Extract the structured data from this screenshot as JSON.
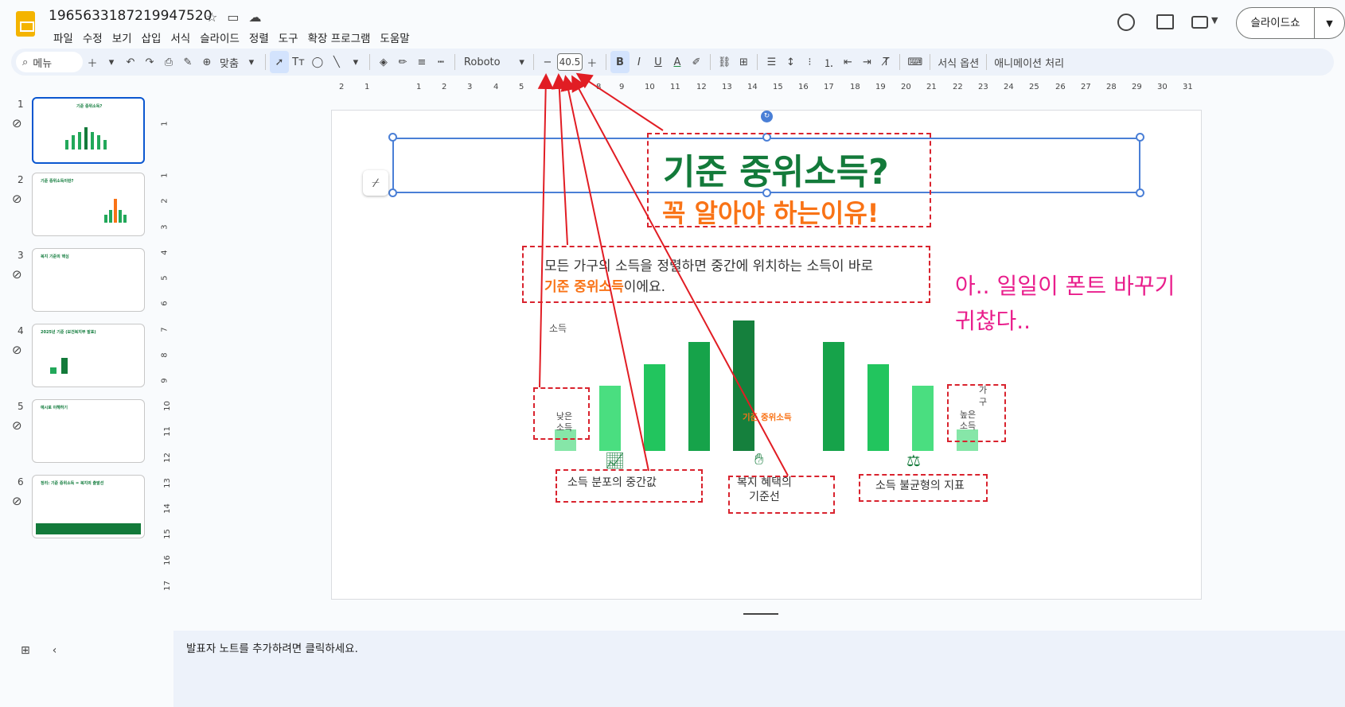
{
  "app": {
    "doc_title": "1965633187219947520",
    "menu": [
      "파일",
      "수정",
      "보기",
      "삽입",
      "서식",
      "슬라이드",
      "정렬",
      "도구",
      "확장 프로그램",
      "도움말"
    ],
    "slideshow_label": "슬라이드쇼"
  },
  "toolbar": {
    "menu_search": "메뉴",
    "zoom": "맞춤",
    "font": "Roboto",
    "font_size": "40.5",
    "format_options": "서식 옵션",
    "animate": "애니메이션 처리"
  },
  "ruler": {
    "h": [
      "2",
      "1",
      "1",
      "2",
      "3",
      "4",
      "5",
      "6",
      "7",
      "8",
      "9",
      "10",
      "11",
      "12",
      "13",
      "14",
      "15",
      "16",
      "17",
      "18",
      "19",
      "20",
      "21",
      "22",
      "23",
      "24",
      "25",
      "26",
      "27",
      "28",
      "29",
      "30",
      "31"
    ],
    "v": [
      "1",
      "1",
      "2",
      "3",
      "4",
      "5",
      "6",
      "7",
      "8",
      "9",
      "10",
      "11",
      "12",
      "13",
      "14",
      "15",
      "16",
      "17"
    ]
  },
  "thumbnails": [
    {
      "num": "1",
      "title": "기준 중위소득?"
    },
    {
      "num": "2",
      "title": "기준 중위소득이란?"
    },
    {
      "num": "3",
      "title": "복지 기준의 핵심"
    },
    {
      "num": "4",
      "title": "2025년 기준 (보건복지부 발표)"
    },
    {
      "num": "5",
      "title": "예시로 이해하기"
    },
    {
      "num": "6",
      "title": "정리: 기준 중위소득 = 복지의 출발선"
    }
  ],
  "slide": {
    "title": "기준 중위소득?",
    "subtitle": "꼭 알아야 하는이유!",
    "body_line1": "모든 가구의 소득을 정렬하면 중간에 위치하는 소득이 바로",
    "body_highlight": "기준 중위소득",
    "body_tail": "이에요.",
    "axis_label": "소득",
    "low_label": "낮은\n소득",
    "high_label": "높은\n소득",
    "median_label": "기준 중위소득",
    "household_label": "가구",
    "captions": [
      "소득 분포의 중간값",
      "복지 혜택의\n기준선",
      "소득 불균형의 지표"
    ],
    "icons": [
      "line-chart-icon",
      "hand-coin-icon",
      "scale-icon"
    ]
  },
  "chart_data": {
    "type": "bar",
    "categories": [
      "낮은 소득",
      "",
      "",
      "",
      "기준 중위소득",
      "",
      "",
      "",
      "높은 소득"
    ],
    "values": [
      1,
      3,
      4,
      5,
      6,
      5,
      4,
      3,
      1
    ],
    "xlabel": "가구",
    "ylabel": "소득",
    "colors": [
      "#86e6a8",
      "#4ade80",
      "#22c55e",
      "#16a34a",
      "#15803d",
      "#16a34a",
      "#22c55e",
      "#4ade80",
      "#86e6a8"
    ]
  },
  "annotation": {
    "text_line1": "아.. 일일이 폰트 바꾸기",
    "text_line2": "귀찮다..",
    "color": "#e91e8c"
  },
  "notes": {
    "placeholder": "발표자 노트를 추가하려면 클릭하세요."
  }
}
